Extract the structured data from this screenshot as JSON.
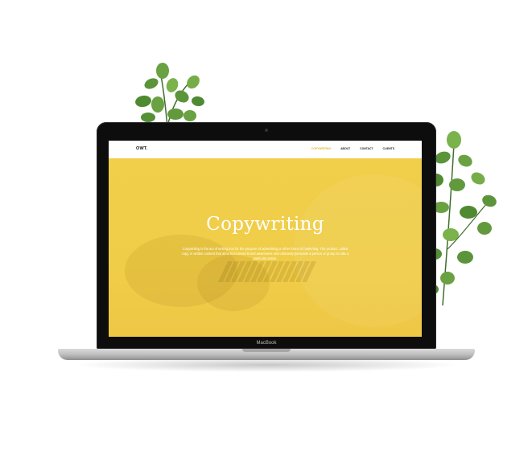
{
  "site": {
    "logo": "OWT.",
    "nav": [
      "COPYWRITING",
      "ABOUT",
      "CONTACT",
      "CLIENTS"
    ],
    "hero_title": "Copywriting",
    "hero_text": "Copywriting is the act of writing text for the purpose of advertising or other forms of marketing. The product, called copy, is written content that aims to increase brand awareness and ultimately persuade a person or group to take a particular action.",
    "accent_color": "#F0CD48",
    "nav_active_color": "#E6B42C"
  },
  "device": {
    "label": "MacBook"
  }
}
